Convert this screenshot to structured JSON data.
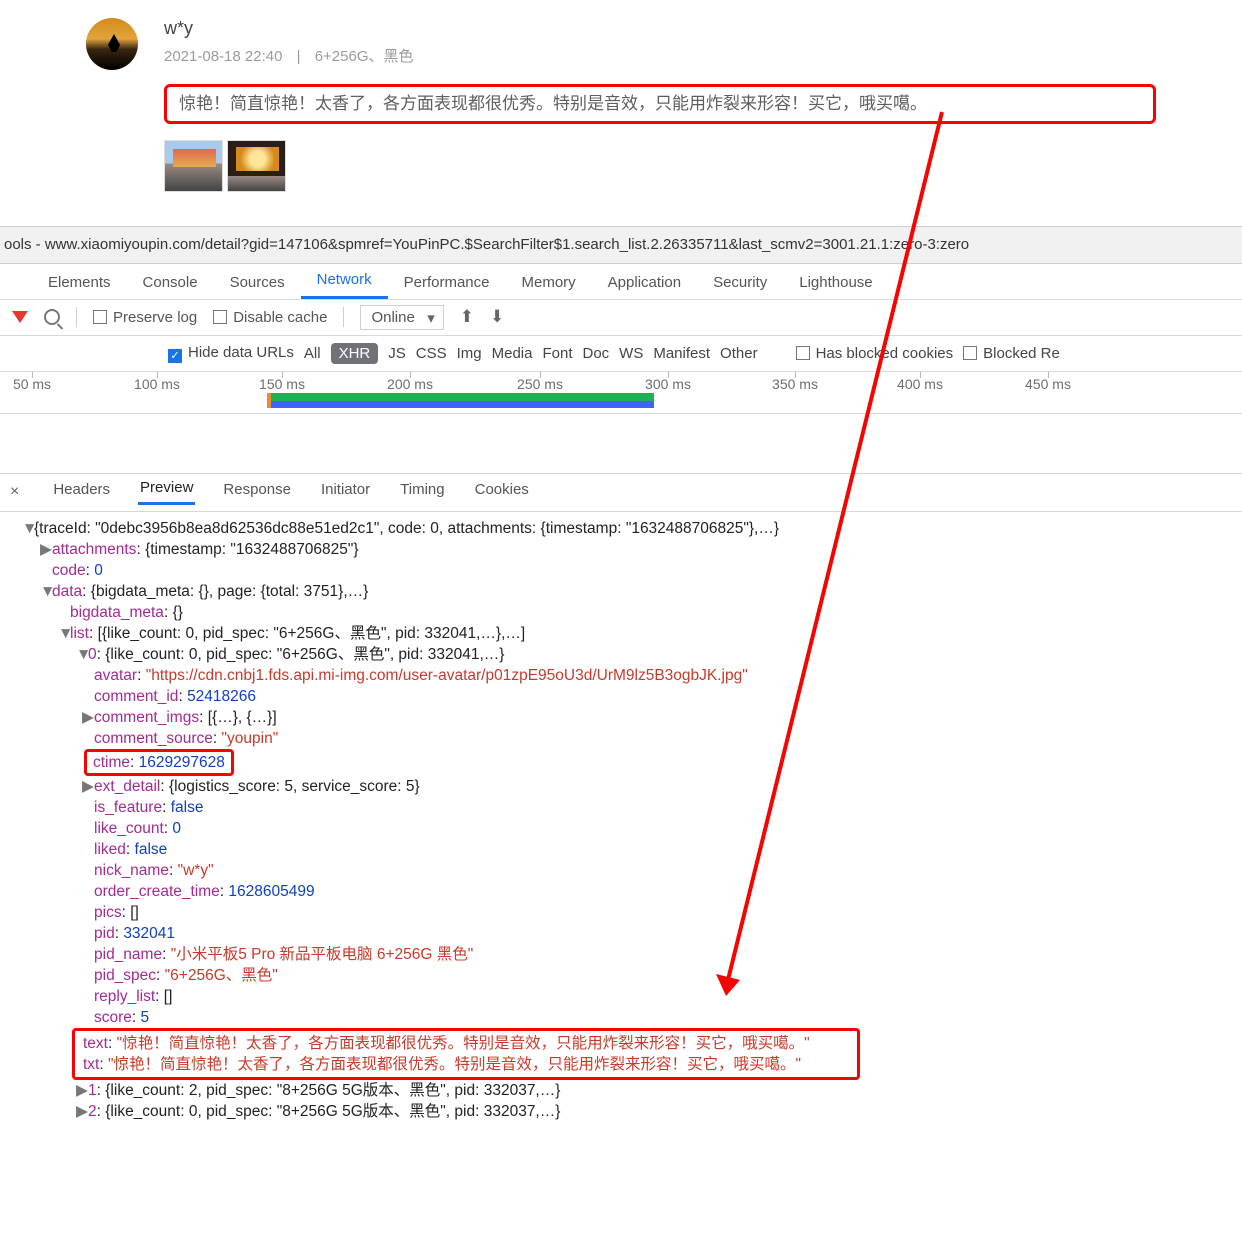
{
  "review": {
    "nick": "w*y",
    "date": "2021-08-18 22:40",
    "spec": "6+256G、黑色",
    "text": "惊艳！简直惊艳！太香了，各方面表现都很优秀。特别是音效，只能用炸裂来形容！买它，哦买噶。"
  },
  "devtools": {
    "titlebar": "ools - www.xiaomiyoupin.com/detail?gid=147106&spmref=YouPinPC.$SearchFilter$1.search_list.2.26335711&last_scmv2=3001.21.1:zero-3:zero",
    "tabs": {
      "elements": "Elements",
      "console": "Console",
      "sources": "Sources",
      "network": "Network",
      "performance": "Performance",
      "memory": "Memory",
      "application": "Application",
      "security": "Security",
      "lighthouse": "Lighthouse"
    },
    "toolbar1": {
      "preserve": "Preserve log",
      "disable": "Disable cache",
      "online": "Online"
    },
    "toolbar2": {
      "hide": "Hide data URLs",
      "all": "All",
      "xhr": "XHR",
      "js": "JS",
      "css": "CSS",
      "img": "Img",
      "media": "Media",
      "font": "Font",
      "doc": "Doc",
      "ws": "WS",
      "manifest": "Manifest",
      "other": "Other",
      "blocked_cookies": "Has blocked cookies",
      "blocked_req": "Blocked Re"
    },
    "ticks": [
      "50 ms",
      "100 ms",
      "150 ms",
      "200 ms",
      "250 ms",
      "300 ms",
      "350 ms",
      "400 ms",
      "450 ms"
    ],
    "subtabs": {
      "headers": "Headers",
      "preview": "Preview",
      "response": "Response",
      "initiator": "Initiator",
      "timing": "Timing",
      "cookies": "Cookies"
    }
  },
  "json_summary_line": "{traceId: \"0debc3956b8ea8d62536dc88e51ed2c1\", code: 0, attachments: {timestamp: \"1632488706825\"},…}",
  "j": {
    "attachments_key": "attachments",
    "attachments_val": "{timestamp: \"1632488706825\"}",
    "code_key": "code",
    "code_val": "0",
    "data_key": "data",
    "data_val": "{bigdata_meta: {}, page: {total: 3751},…}",
    "bigdata_key": "bigdata_meta",
    "bigdata_val": "{}",
    "list_key": "list",
    "list_val": "[{like_count: 0, pid_spec: \"6+256G、黑色\", pid: 332041,…},…]",
    "idx0_key": "0",
    "idx0_val": "{like_count: 0, pid_spec: \"6+256G、黑色\", pid: 332041,…}",
    "avatar_key": "avatar",
    "avatar_val": "\"https://cdn.cnbj1.fds.api.mi-img.com/user-avatar/p01zpE95oU3d/UrM9lz5B3ogbJK.jpg\"",
    "commentid_key": "comment_id",
    "commentid_val": "52418266",
    "commentimgs_key": "comment_imgs",
    "commentimgs_val": "[{…}, {…}]",
    "commentsrc_key": "comment_source",
    "commentsrc_val": "\"youpin\"",
    "ctime_key": "ctime",
    "ctime_val": "1629297628",
    "ext_key": "ext_detail",
    "ext_val": "{logistics_score: 5, service_score: 5}",
    "isfeat_key": "is_feature",
    "isfeat_val": "false",
    "likecount_key": "like_count",
    "likecount_val": "0",
    "liked_key": "liked",
    "liked_val": "false",
    "nick_key": "nick_name",
    "nick_val": "\"w*y\"",
    "order_key": "order_create_time",
    "order_val": "1628605499",
    "pics_key": "pics",
    "pics_val": "[]",
    "pid_key": "pid",
    "pid_val": "332041",
    "pidname_key": "pid_name",
    "pidname_val": "\"小米平板5 Pro 新品平板电脑 6+256G  黑色\"",
    "pidspec_key": "pid_spec",
    "pidspec_val": "\"6+256G、黑色\"",
    "reply_key": "reply_list",
    "reply_val": "[]",
    "score_key": "score",
    "score_val": "5",
    "text_key": "text",
    "text_val": "\"惊艳！简直惊艳！太香了，各方面表现都很优秀。特别是音效，只能用炸裂来形容！买它，哦买噶。\"",
    "txt_key": "txt",
    "txt_val": "\"惊艳！简直惊艳！太香了，各方面表现都很优秀。特别是音效，只能用炸裂来形容！买它，哦买噶。\"",
    "idx1_key": "1",
    "idx1_val": "{like_count: 2, pid_spec: \"8+256G 5G版本、黑色\", pid: 332037,…}",
    "idx2_key": "2",
    "idx2_val": "{like_count: 0, pid_spec: \"8+256G 5G版本、黑色\", pid: 332037,…}"
  }
}
